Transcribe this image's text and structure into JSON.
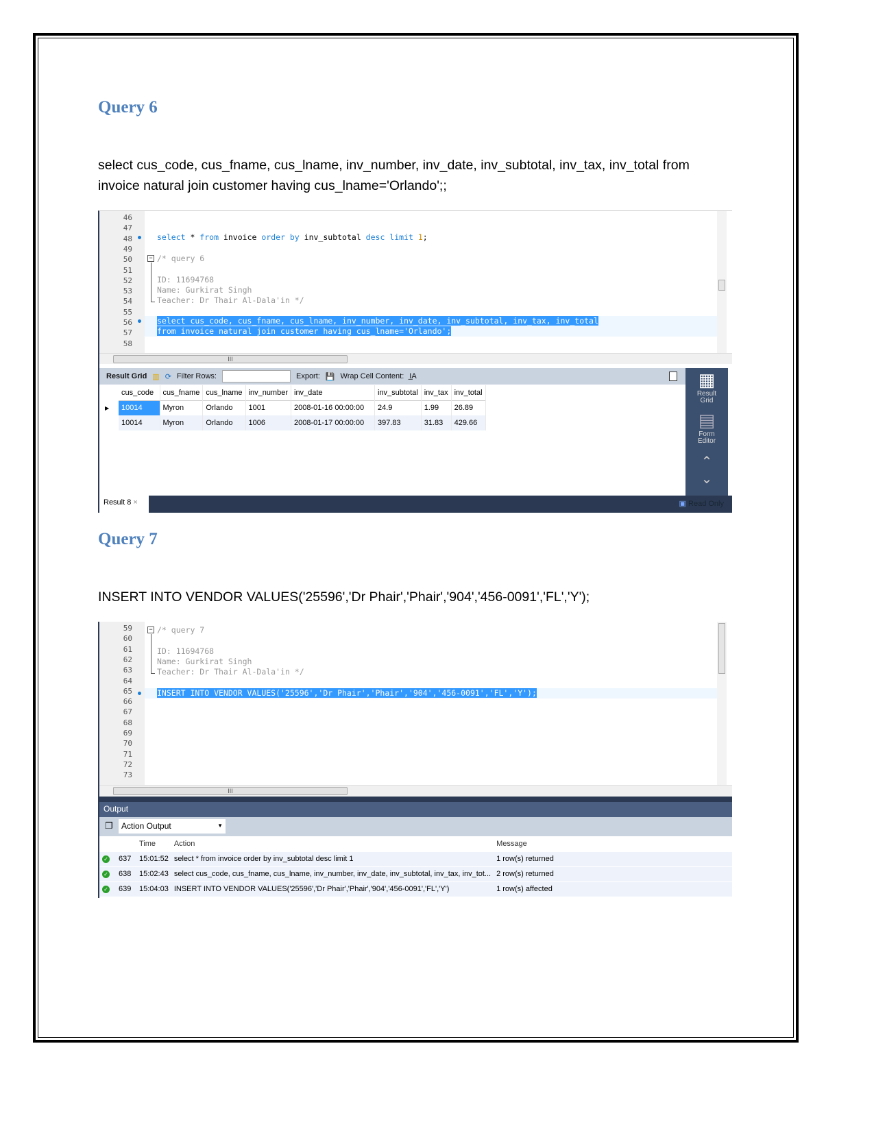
{
  "query6": {
    "heading": "Query 6",
    "sql_line1": "select cus_code, cus_fname, cus_lname, inv_number, inv_date, inv_subtotal, inv_tax, inv_total from",
    "sql_line2": "invoice natural join customer having cus_lname='Orlando';;"
  },
  "editor1": {
    "line_numbers": [
      "46",
      "47",
      "48",
      "49",
      "50",
      "51",
      "52",
      "53",
      "54",
      "55",
      "56",
      "57",
      "58"
    ],
    "l48": {
      "a": "select",
      "b": " * ",
      "c": "from",
      "d": " invoice ",
      "e": "order by",
      "f": " inv_subtotal ",
      "g": "desc limit",
      "h": " 1",
      ";": ";"
    },
    "comment": [
      "/* query 6",
      "",
      "ID: 11694768",
      "Name: Gurkirat Singh",
      "Teacher: Dr Thair Al-Dala'in */"
    ],
    "selected": [
      "select cus_code, cus_fname, cus_lname, inv_number, inv_date, inv_subtotal, inv_tax, inv_total",
      "from invoice natural join customer having cus_lname='Orlando';"
    ]
  },
  "results": {
    "toolbar": {
      "result_grid": "Result Grid",
      "filter_rows": "Filter Rows:",
      "filter_value": "",
      "export": "Export:",
      "wrap": "Wrap Cell Content:"
    },
    "columns": [
      "cus_code",
      "cus_fname",
      "cus_lname",
      "inv_number",
      "inv_date",
      "inv_subtotal",
      "inv_tax",
      "inv_total"
    ],
    "rows": [
      [
        "10014",
        "Myron",
        "Orlando",
        "1001",
        "2008-01-16 00:00:00",
        "24.9",
        "1.99",
        "26.89"
      ],
      [
        "10014",
        "Myron",
        "Orlando",
        "1006",
        "2008-01-17 00:00:00",
        "397.83",
        "31.83",
        "429.66"
      ]
    ],
    "side": {
      "result_grid": "Result Grid",
      "form_editor": "Form Editor"
    },
    "tab": "Result 8",
    "status": "Read Only"
  },
  "query7": {
    "heading": "Query 7",
    "sql": "INSERT INTO VENDOR VALUES('25596','Dr Phair','Phair','904','456-0091','FL','Y');"
  },
  "editor2": {
    "line_numbers": [
      "59",
      "60",
      "61",
      "62",
      "63",
      "64",
      "65",
      "66",
      "67",
      "68",
      "69",
      "70",
      "71",
      "72",
      "73"
    ],
    "comment": [
      "/* query 7",
      "",
      "ID: 11694768",
      "Name: Gurkirat Singh",
      "Teacher: Dr Thair Al-Dala'in */"
    ],
    "selected": "INSERT INTO VENDOR VALUES('25596','Dr Phair','Phair','904','456-0091','FL','Y');"
  },
  "output": {
    "title": "Output",
    "dropdown": "Action Output",
    "columns": [
      "",
      "",
      "Time",
      "Action",
      "Message"
    ],
    "rows": [
      [
        "637",
        "15:01:52",
        "select * from invoice order by inv_subtotal desc limit 1",
        "1 row(s) returned"
      ],
      [
        "638",
        "15:02:43",
        "select cus_code, cus_fname, cus_lname, inv_number, inv_date, inv_subtotal, inv_tax, inv_tot...",
        "2 row(s) returned"
      ],
      [
        "639",
        "15:04:03",
        "INSERT INTO VENDOR VALUES('25596','Dr Phair','Phair','904','456-0091','FL','Y')",
        "1 row(s) affected"
      ]
    ]
  },
  "colors": {
    "heading": "#4f81bd",
    "selection": "#3399ff",
    "keyword": "#1a7fd6",
    "panel": "#3b4f6e"
  }
}
